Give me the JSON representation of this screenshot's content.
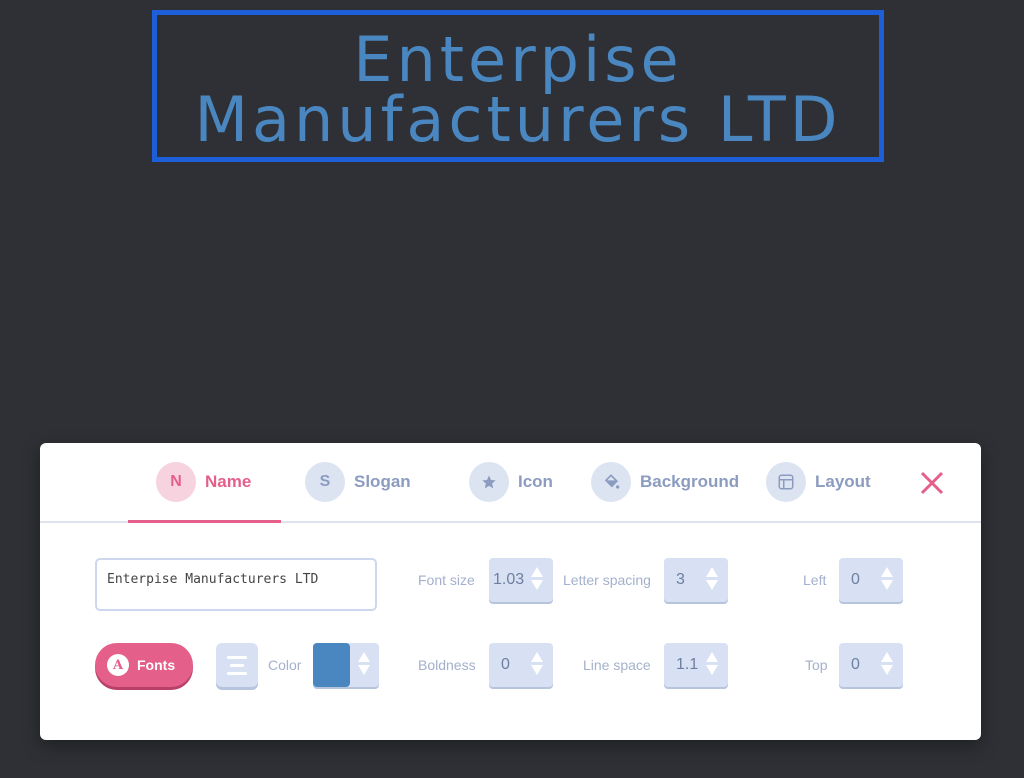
{
  "logo": {
    "line1": "Enterpise",
    "line2": "Manufacturers LTD",
    "text_color": "#4a87c0",
    "frame_color": "#1c5fd8"
  },
  "tabs": [
    {
      "label": "Name",
      "icon_letter": "N",
      "active": true
    },
    {
      "label": "Slogan",
      "icon_letter": "S",
      "active": false
    },
    {
      "label": "Icon",
      "icon": "star-icon",
      "active": false
    },
    {
      "label": "Background",
      "icon": "paint-bucket-icon",
      "active": false
    },
    {
      "label": "Layout",
      "icon": "layout-icon",
      "active": false
    }
  ],
  "close_icon": "close-icon",
  "name_field": {
    "value": "Enterpise Manufacturers LTD"
  },
  "fonts_button": {
    "icon_letter": "A",
    "label": "Fonts"
  },
  "align_icon": "align-center-icon",
  "color": {
    "label": "Color",
    "value": "#4a87c0"
  },
  "fields": {
    "font_size": {
      "label": "Font size",
      "value": "1.03"
    },
    "letter_spacing": {
      "label": "Letter spacing",
      "value": "3"
    },
    "left": {
      "label": "Left",
      "value": "0"
    },
    "boldness": {
      "label": "Boldness",
      "value": "0"
    },
    "line_space": {
      "label": "Line space",
      "value": "1.1"
    },
    "top": {
      "label": "Top",
      "value": "0"
    }
  },
  "accent_color": "#e4608a"
}
